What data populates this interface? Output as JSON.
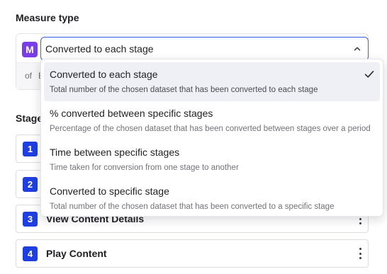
{
  "measure_type": {
    "label": "Measure type",
    "badge": "M",
    "selected_value": "Converted to each stage",
    "of_label": "of",
    "of_value": "E"
  },
  "dropdown": {
    "options": [
      {
        "title": "Converted to each stage",
        "description": "Total number of the chosen dataset that has been converted to each stage",
        "selected": true
      },
      {
        "title": "% converted between specific stages",
        "description": "Percentage of the chosen dataset that has been converted between stages over a period",
        "selected": false
      },
      {
        "title": "Time between specific stages",
        "description": "Time taken for conversion from one stage to another",
        "selected": false
      },
      {
        "title": "Converted to specific stage",
        "description": "Total number of the chosen dataset that has been converted to a specific stage",
        "selected": false
      }
    ]
  },
  "stages": {
    "label": "Stage",
    "items": [
      {
        "number": "1",
        "name": ""
      },
      {
        "number": "2",
        "name": ""
      },
      {
        "number": "3",
        "name": "View Content Details"
      },
      {
        "number": "4",
        "name": "Play Content"
      }
    ]
  },
  "colors": {
    "badge_purple": "#7a3ee8",
    "stage_blue": "#1f3fe0",
    "focus_border": "#3b5ee8",
    "selected_option_bg": "#eef0f6"
  }
}
